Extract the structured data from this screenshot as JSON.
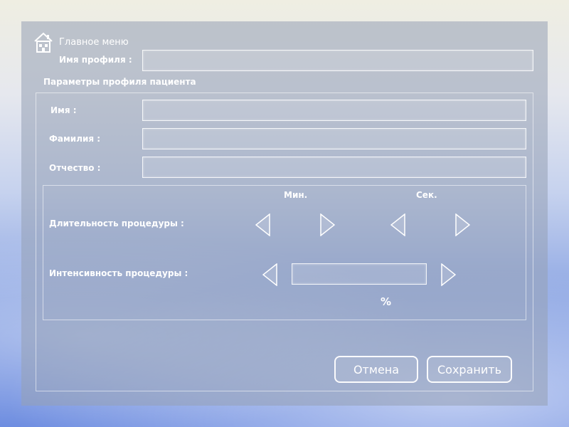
{
  "header": {
    "title": "Главное меню",
    "home_icon": "home-icon"
  },
  "profile": {
    "label": "Имя профиля :",
    "value": ""
  },
  "patient_section": {
    "title": "Параметры профиля пациента",
    "first_name": {
      "label": "Имя :",
      "value": ""
    },
    "last_name": {
      "label": "Фамилия :",
      "value": ""
    },
    "patronymic": {
      "label": "Отчество :",
      "value": ""
    }
  },
  "procedure": {
    "minutes_label": "Мин.",
    "seconds_label": "Сек.",
    "duration_label": "Длительность процедуры :",
    "intensity_label": "Интенсивность процедуры :",
    "intensity_value": "",
    "percent_label": "%"
  },
  "buttons": {
    "cancel": "Отмена",
    "save": "Сохранить"
  }
}
